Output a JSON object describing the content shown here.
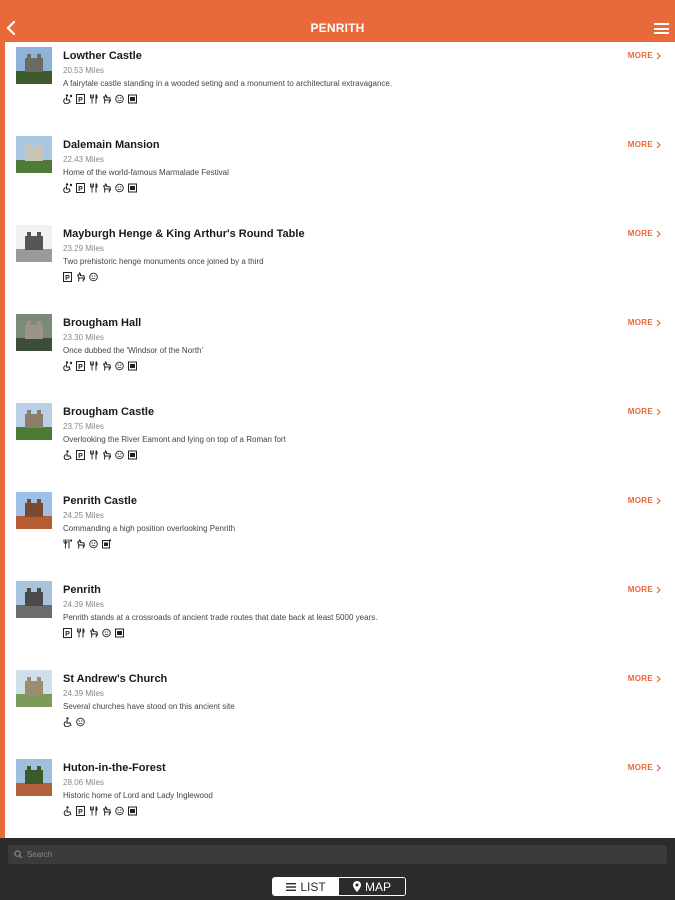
{
  "header": {
    "title": "PENRITH"
  },
  "list_more_label": "MORE",
  "items": [
    {
      "name": "Lowther Castle",
      "distance": "20.53 Miles",
      "description": "A fairytale castle standing in a wooded seting and a monument to architectural extravagance.",
      "facilities": [
        "wheelchair-partial-icon",
        "parking-icon",
        "cafe-icon",
        "dog-icon",
        "toilets-icon",
        "shop-icon"
      ],
      "thumb_colors": [
        "#8fb3d6",
        "#3f5a2d",
        "#6d6a63"
      ]
    },
    {
      "name": "Dalemain Mansion",
      "distance": "22.43 Miles",
      "description": "Home of the world-famous Marmalade Festival",
      "facilities": [
        "wheelchair-partial-icon",
        "parking-icon",
        "cafe-icon",
        "dog-icon",
        "toilets-icon",
        "shop-icon"
      ],
      "thumb_colors": [
        "#a9c6e3",
        "#4f7a3a",
        "#c9c3b8"
      ]
    },
    {
      "name": "Mayburgh Henge & King Arthur's Round Table",
      "distance": "23.29 Miles",
      "description": "Two prehistoric henge monuments once joined by a third",
      "facilities": [
        "parking-icon",
        "dog-icon",
        "toilets-icon"
      ],
      "thumb_colors": [
        "#f1f1f1",
        "#9a9a9a",
        "#555555"
      ]
    },
    {
      "name": "Brougham Hall",
      "distance": "23.30 Miles",
      "description": "Once dubbed the 'Windsor of the North'",
      "facilities": [
        "wheelchair-partial-icon",
        "parking-icon",
        "cafe-icon",
        "dog-icon",
        "toilets-icon",
        "shop-icon"
      ],
      "thumb_colors": [
        "#7c8a7a",
        "#3d4d3c",
        "#9c9585"
      ]
    },
    {
      "name": "Brougham Castle",
      "distance": "23.75 Miles",
      "description": "Overlooking the River Eamont and lying on top of a Roman fort",
      "facilities": [
        "wheelchair-icon",
        "parking-icon",
        "cafe-icon",
        "dog-icon",
        "toilets-icon",
        "shop-icon"
      ],
      "thumb_colors": [
        "#b9d0e6",
        "#4c7a32",
        "#8a7d6a"
      ]
    },
    {
      "name": "Penrith Castle",
      "distance": "24.25 Miles",
      "description": "Commanding a high position overlooking Penrith",
      "facilities": [
        "cafe-partial-icon",
        "dog-icon",
        "toilets-icon",
        "shop-partial-icon"
      ],
      "thumb_colors": [
        "#9cc0e6",
        "#b85a32",
        "#7a4a30"
      ]
    },
    {
      "name": "Penrith",
      "distance": "24.39 Miles",
      "description": "Penrith stands at a crossroads of ancient trade routes that date back at least 5000 years.",
      "facilities": [
        "parking-icon",
        "cafe-icon",
        "dog-icon",
        "toilets-icon",
        "shop-icon"
      ],
      "thumb_colors": [
        "#a7c3de",
        "#6b6b6b",
        "#4a4a4a"
      ]
    },
    {
      "name": "St Andrew's Church",
      "distance": "24.39 Miles",
      "description": "Several churches have stood on this ancient site",
      "facilities": [
        "wheelchair-icon",
        "toilets-icon"
      ],
      "thumb_colors": [
        "#cfe0ea",
        "#7c9a5a",
        "#9a8e6e"
      ]
    },
    {
      "name": "Huton-in-the-Forest",
      "distance": "28.06 Miles",
      "description": "Historic home of Lord and Lady Inglewood",
      "facilities": [
        "wheelchair-icon",
        "parking-icon",
        "cafe-icon",
        "dog-icon",
        "toilets-icon",
        "shop-icon"
      ],
      "thumb_colors": [
        "#9fc0dc",
        "#b0603a",
        "#3c5a2a"
      ]
    }
  ],
  "search": {
    "placeholder": "Search",
    "value": ""
  },
  "view_toggle": {
    "list_label": "LIST",
    "map_label": "MAP",
    "selected": "LIST"
  },
  "colors": {
    "accent": "#e8693a",
    "bottom_bar": "#2b2b2b"
  }
}
